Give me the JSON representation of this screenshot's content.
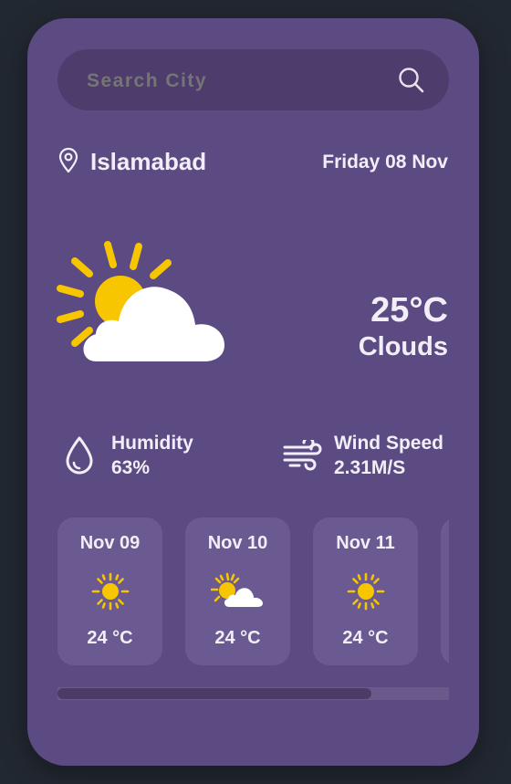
{
  "search": {
    "placeholder": "Search City"
  },
  "location": {
    "city": "Islamabad",
    "date": "Friday 08 Nov"
  },
  "current": {
    "temperature": "25°C",
    "description": "Clouds",
    "icon": "sun-behind-cloud-icon"
  },
  "stats": {
    "humidity_label": "Humidity",
    "humidity_value": "63%",
    "wind_label": "Wind Speed",
    "wind_value": "2.31M/S"
  },
  "forecast": [
    {
      "date": "Nov 09",
      "temp": "24 °C",
      "icon": "sun-icon"
    },
    {
      "date": "Nov 10",
      "temp": "24 °C",
      "icon": "sun-behind-cloud-icon"
    },
    {
      "date": "Nov 11",
      "temp": "24 °C",
      "icon": "sun-icon"
    },
    {
      "date": "",
      "temp": "",
      "icon": ""
    }
  ],
  "colors": {
    "background": "#222831",
    "card": "#5c4a82",
    "search_field": "#4e3d6c",
    "forecast_card": "#6b5a91",
    "sun": "#f7c600",
    "text": "#f2eef7"
  },
  "scroll": {
    "horizontal_position_fraction": 0
  }
}
